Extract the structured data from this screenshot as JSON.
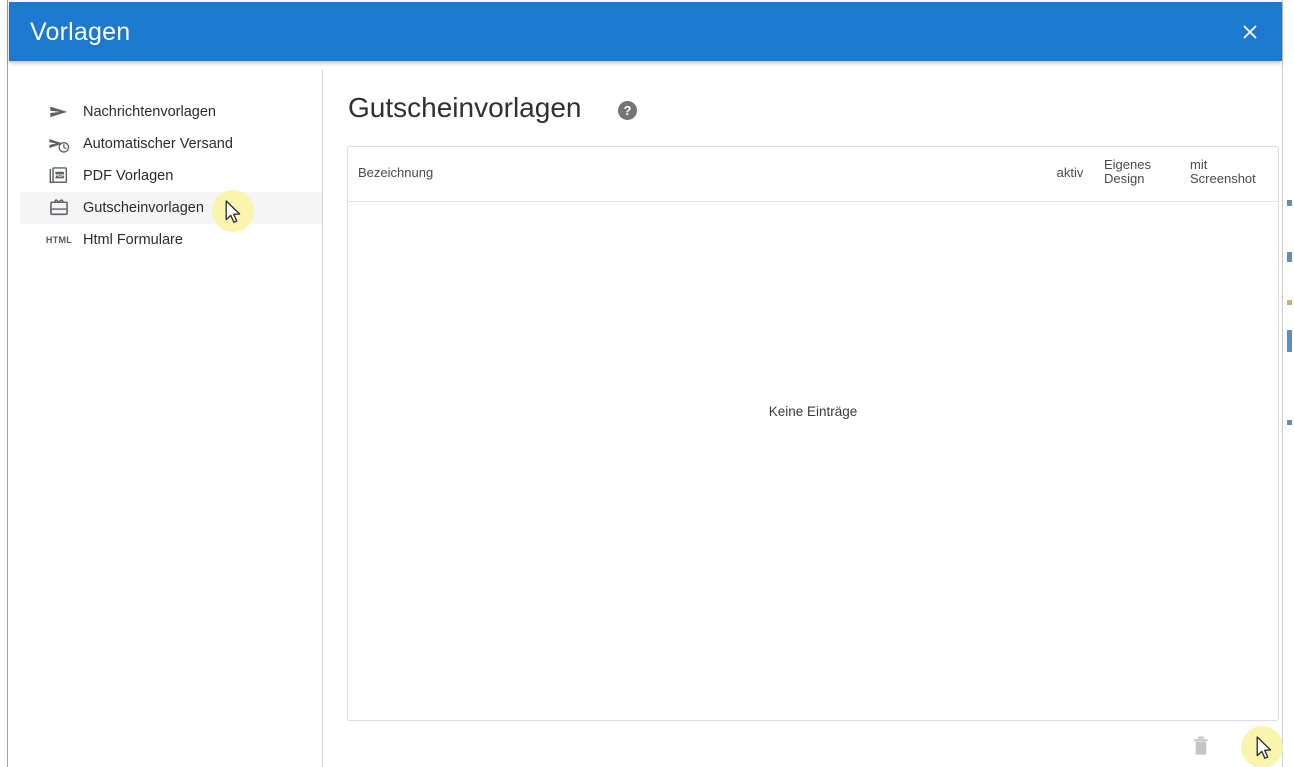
{
  "window": {
    "title": "Vorlagen",
    "close_label": "×",
    "header_color": "#1b79d0"
  },
  "sidebar": {
    "items": [
      {
        "label": "Nachrichtenvorlagen",
        "icon": "send-icon",
        "selected": false
      },
      {
        "label": "Automatischer Versand",
        "icon": "send-clock-icon",
        "selected": false
      },
      {
        "label": "PDF Vorlagen",
        "icon": "pdf-icon",
        "selected": false
      },
      {
        "label": "Gutscheinvorlagen",
        "icon": "voucher-icon",
        "selected": true
      },
      {
        "label": "Html Formulare",
        "icon": "html-icon",
        "selected": false
      }
    ]
  },
  "main": {
    "page_title": "Gutscheinvorlagen",
    "help_glyph": "?",
    "help_tooltip": "Hilfe",
    "table": {
      "columns": [
        {
          "key": "bezeichnung",
          "label": "Bezeichnung"
        },
        {
          "key": "aktiv",
          "label": "aktiv"
        },
        {
          "key": "design",
          "label": "Eigenes\nDesign"
        },
        {
          "key": "screenshot",
          "label": "mit\nScreenshot"
        }
      ],
      "rows": [],
      "empty_text": "Keine Einträge"
    },
    "actions": {
      "delete_label": "delete-icon",
      "add_label": "add-icon"
    }
  }
}
